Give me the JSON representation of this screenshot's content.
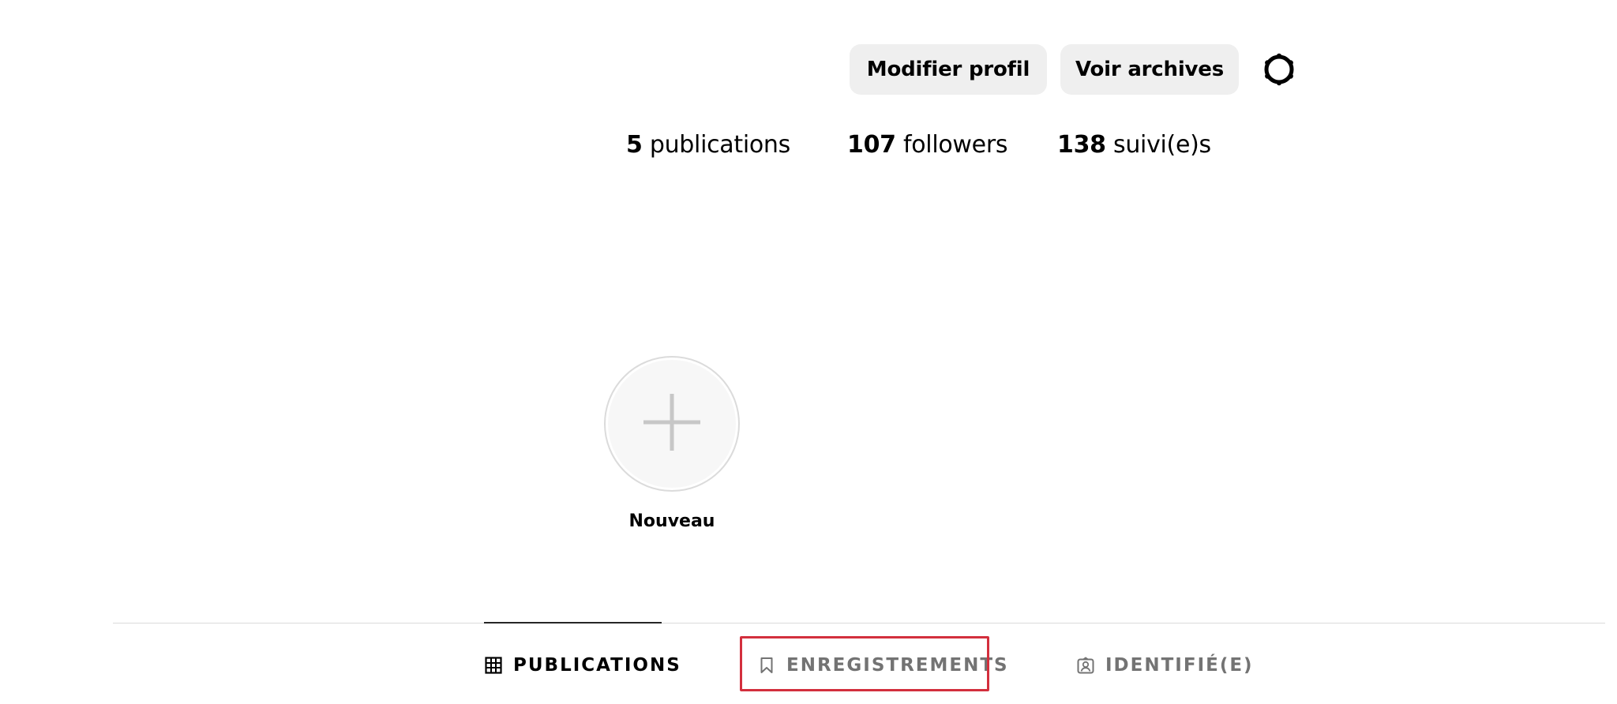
{
  "header": {
    "edit_profile_label": "Modifier profil",
    "view_archive_label": "Voir archives",
    "settings_icon": "gear-icon"
  },
  "stats": {
    "posts_count": "5",
    "posts_label": "publications",
    "followers_count": "107",
    "followers_label": "followers",
    "following_count": "138",
    "following_label": "suivi(e)s"
  },
  "highlights": {
    "new_label": "Nouveau",
    "new_icon": "plus-icon"
  },
  "tabs": [
    {
      "label": "PUBLICATIONS",
      "icon": "grid-icon",
      "active": true
    },
    {
      "label": "ENREGISTREMENTS",
      "icon": "bookmark-icon",
      "active": false,
      "highlighted": true
    },
    {
      "label": "IDENTIFIÉ(E)",
      "icon": "tagged-user-icon",
      "active": false
    }
  ],
  "colors": {
    "button_bg": "#efefef",
    "divider": "#dbdbdb",
    "tab_inactive": "#737373",
    "tab_active": "#000000",
    "highlight_outline": "#d32f3d"
  }
}
